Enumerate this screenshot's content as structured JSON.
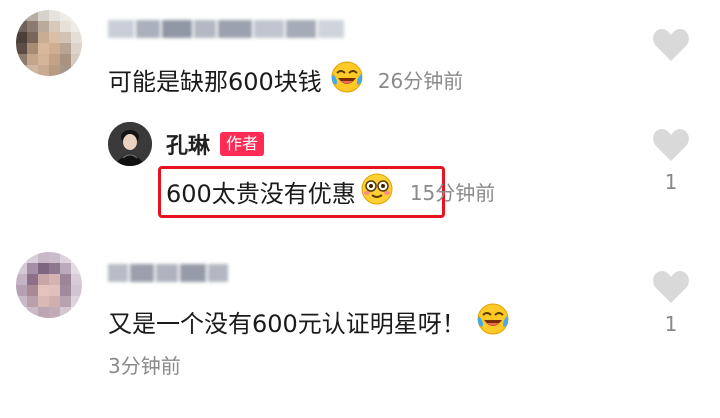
{
  "comments": [
    {
      "text": "可能是缺那600块钱",
      "emoji": "laughing-tears-emoji",
      "time": "26分钟前"
    },
    {
      "reply": true,
      "author": "孔琳",
      "badge": "作者",
      "text": "600太贵没有优惠",
      "emoji": "smiling-glasses-emoji",
      "time": "15分钟前",
      "likes": "1"
    },
    {
      "text": "又是一个没有600元认证明星呀！",
      "emoji": "laughing-tears-emoji",
      "time": "3分钟前",
      "likes": "1"
    }
  ],
  "colors": {
    "badge": "#fe2c55",
    "highlight_border": "#e8131f",
    "timestamp": "#8a8a8a",
    "heart": "#d9d9d9"
  },
  "icons": [
    "heart-icon",
    "laughing-tears-emoji",
    "smiling-glasses-emoji"
  ]
}
